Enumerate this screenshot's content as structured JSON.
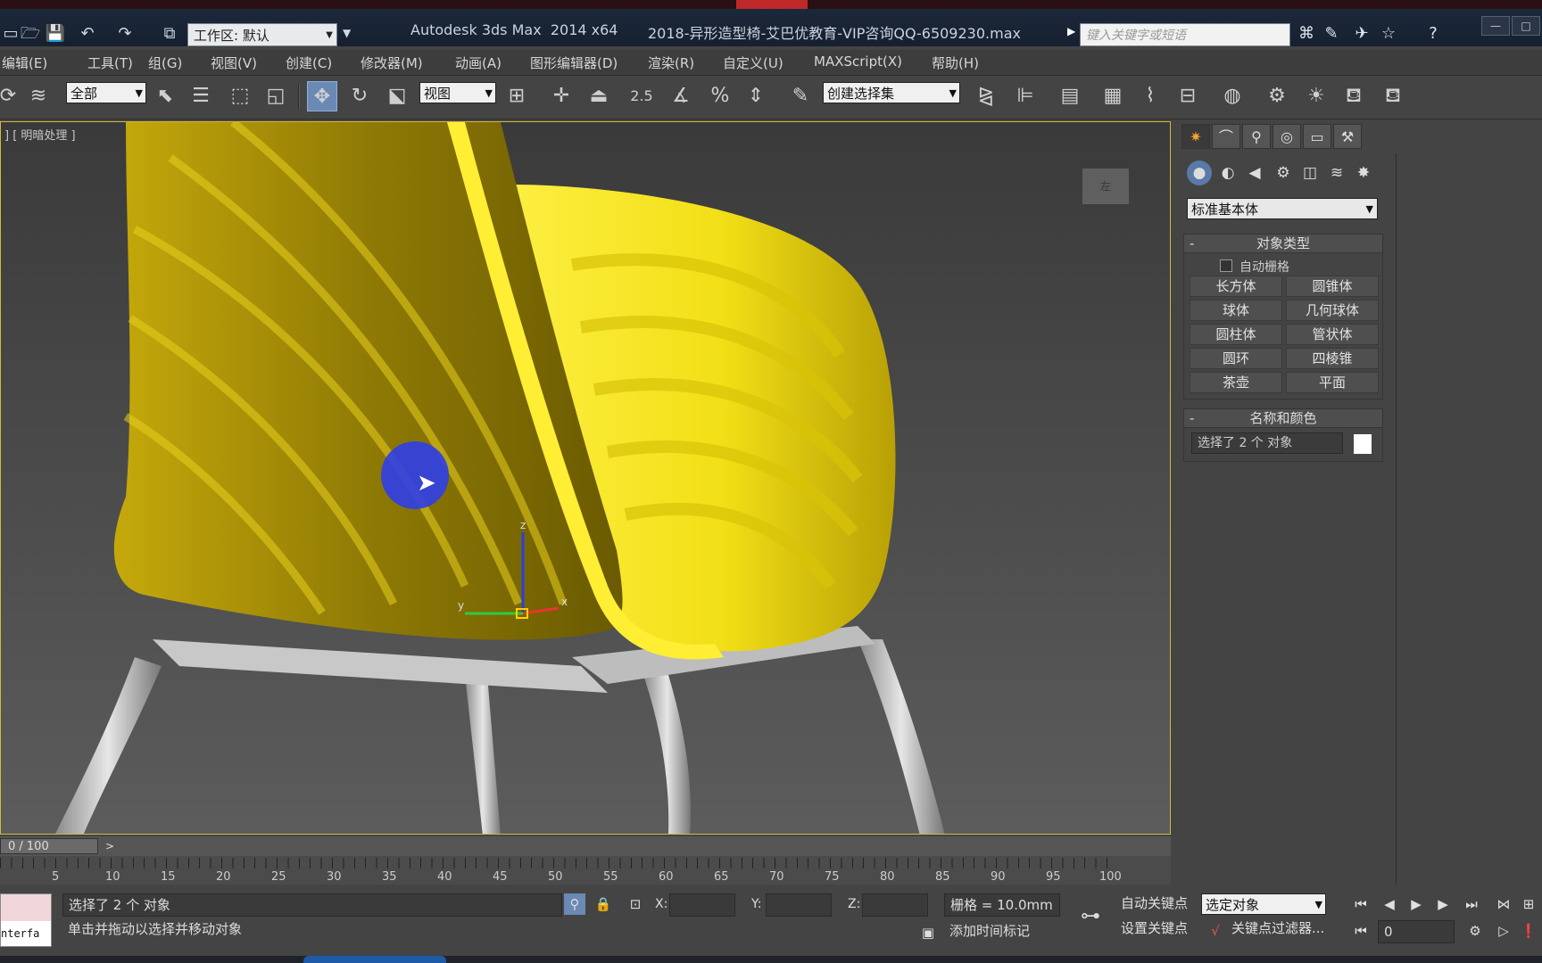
{
  "title_bar": {
    "workspace_label": "工作区: 默认",
    "app_title": "Autodesk 3ds Max  2014 x64",
    "file_title": "2018-异形造型椅-艾巴优教育-VIP咨询QQ-6509230.max",
    "search_placeholder": "键入关键字或短语"
  },
  "menu": {
    "items": [
      "编辑(E)",
      "工具(T)",
      "组(G)",
      "视图(V)",
      "创建(C)",
      "修改器(M)",
      "动画(A)",
      "图形编辑器(D)",
      "渲染(R)",
      "自定义(U)",
      "MAXScript(X)",
      "帮助(H)"
    ]
  },
  "toolbar": {
    "selection_filter": "全部",
    "reference_coord": "视图",
    "snap_angle_label": "2.5",
    "named_selection": "创建选择集"
  },
  "viewport": {
    "label": "] [ 明暗处理 ]",
    "gizmo_x": "x",
    "gizmo_y": "y",
    "gizmo_z": "z",
    "viewcube_label": "左"
  },
  "command_panel": {
    "category_select": "标准基本体",
    "object_type_title": "对象类型",
    "auto_grid_label": "自动栅格",
    "object_buttons": [
      "长方体",
      "圆锥体",
      "球体",
      "几何球体",
      "圆柱体",
      "管状体",
      "圆环",
      "四棱锥",
      "茶壶",
      "平面"
    ],
    "name_color_title": "名称和颜色",
    "name_value": "选择了 2 个 对象",
    "color": "#ffffff"
  },
  "timeline": {
    "frame_display": "0 / 100",
    "next_label": ">",
    "ticks": [
      "5",
      "10",
      "15",
      "20",
      "25",
      "30",
      "35",
      "40",
      "45",
      "50",
      "55",
      "60",
      "65",
      "70",
      "75",
      "80",
      "85",
      "90",
      "95",
      "100"
    ]
  },
  "status": {
    "listener_text": "nterfa",
    "selection_status": "选择了 2 个 对象",
    "prompt": "单击并拖动以选择并移动对象",
    "x_label": "X:",
    "y_label": "Y:",
    "z_label": "Z:",
    "grid_text": "栅格 = 10.0mm",
    "add_time_tag": "添加时间标记",
    "auto_key": "自动关键点",
    "set_key": "设置关键点",
    "key_mode_select": "选定对象",
    "key_filters": "关键点过滤器...",
    "current_frame": "0"
  },
  "colors": {
    "chair_yellow": "#e6d21a",
    "viewport_border": "#d7b83a",
    "cursor_dot": "#2f3ee8"
  }
}
